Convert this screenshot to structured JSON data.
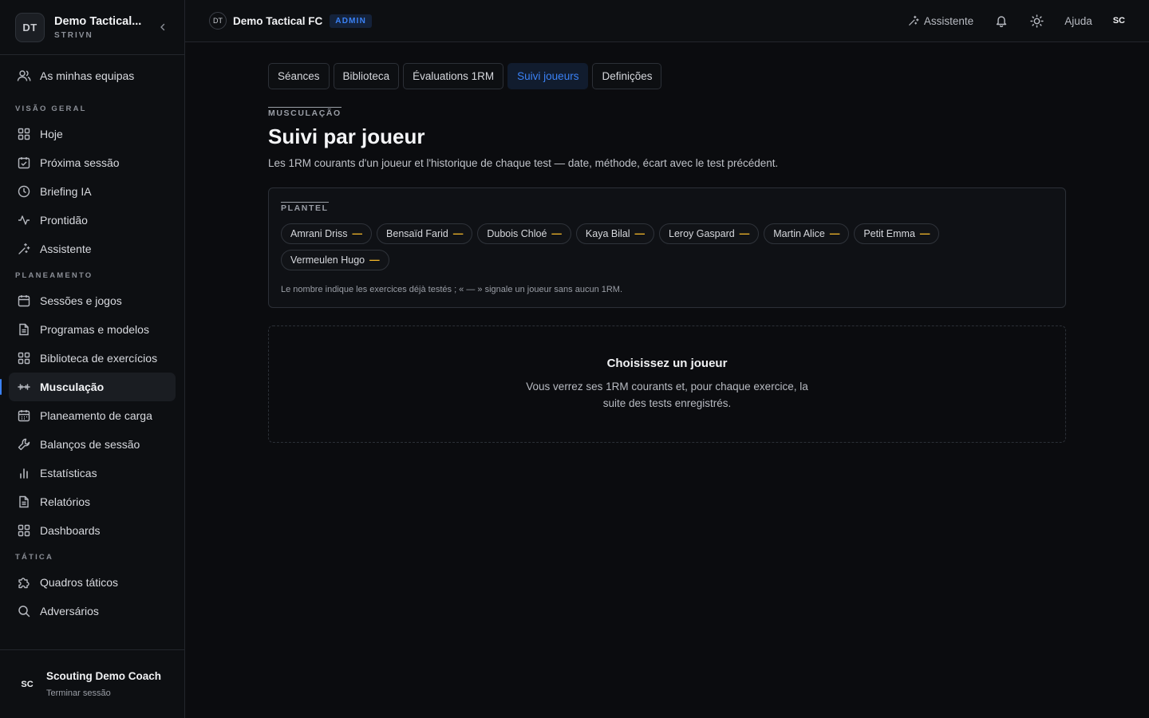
{
  "sidebar": {
    "team_initials": "DT",
    "team_name": "Demo Tactical...",
    "org": "STRIVN",
    "my_teams": "As minhas equipas",
    "sections": {
      "overview": "VISÃO GERAL",
      "planning": "PLANEAMENTO",
      "tactics": "TÁTICA"
    },
    "items": {
      "hoje": "Hoje",
      "proxima": "Próxima sessão",
      "briefing": "Briefing IA",
      "prontidao": "Prontidão",
      "assistente": "Assistente",
      "sessoes": "Sessões e jogos",
      "programas": "Programas e modelos",
      "biblioteca": "Biblioteca de exercícios",
      "musculacao": "Musculação",
      "carga": "Planeamento de carga",
      "balancos": "Balanços de sessão",
      "estatisticas": "Estatísticas",
      "relatorios": "Relatórios",
      "dashboards": "Dashboards",
      "quadros": "Quadros táticos",
      "adversarios": "Adversários"
    },
    "user_initials": "SC",
    "user_name": "Scouting Demo Coach",
    "logout": "Terminar sessão"
  },
  "topbar": {
    "team_initials": "DT",
    "team_name": "Demo Tactical FC",
    "badge": "ADMIN",
    "assistant": "Assistente",
    "help": "Ajuda",
    "user_initials": "SC"
  },
  "tabs": [
    "Séances",
    "Biblioteca",
    "Évaluations 1RM",
    "Suivi joueurs",
    "Definições"
  ],
  "page": {
    "kicker": "MUSCULAÇÃO",
    "title": "Suivi par joueur",
    "subtitle": "Les 1RM courants d'un joueur et l'historique de chaque test — date, méthode, écart avec le test précédent."
  },
  "roster": {
    "kicker": "PLANTEL",
    "players": [
      {
        "name": "Amrani Driss",
        "count": "—"
      },
      {
        "name": "Bensaïd Farid",
        "count": "—"
      },
      {
        "name": "Dubois Chloé",
        "count": "—"
      },
      {
        "name": "Kaya Bilal",
        "count": "—"
      },
      {
        "name": "Leroy Gaspard",
        "count": "—"
      },
      {
        "name": "Martin Alice",
        "count": "—"
      },
      {
        "name": "Petit Emma",
        "count": "—"
      },
      {
        "name": "Vermeulen Hugo",
        "count": "—"
      }
    ],
    "note": "Le nombre indique les exercices déjà testés ; « — » signale un joueur sans aucun 1RM."
  },
  "empty_state": {
    "title": "Choisissez un joueur",
    "text": "Vous verrez ses 1RM courants et, pour chaque exercice, la suite des tests enregistrés."
  },
  "colors": {
    "accent": "#3b82f6",
    "dash": "#f0b429",
    "background": "#0b0c0f"
  }
}
